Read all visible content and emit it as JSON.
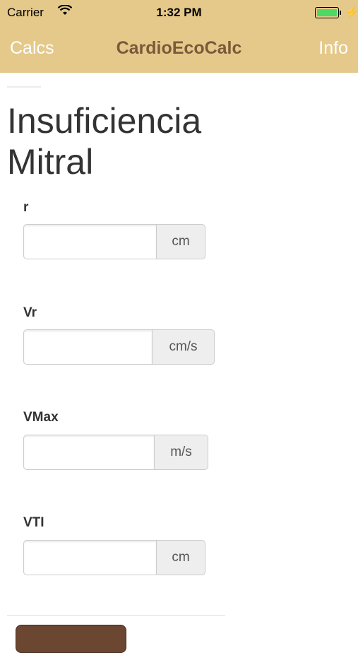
{
  "status_bar": {
    "carrier": "Carrier",
    "time": "1:32 PM",
    "wifi_icon": "wifi-icon",
    "battery_icon": "battery-icon",
    "charging_icon": "charging-bolt-icon",
    "battery_level": 1.0,
    "battery_color": "#4cd964"
  },
  "nav": {
    "left_label": "Calcs",
    "title": "CardioEcoCalc",
    "right_label": "Info",
    "background_color": "#e5c98a",
    "title_color": "#7a5a3a"
  },
  "page": {
    "title": "Insuficiencia Mitral"
  },
  "fields": [
    {
      "label": "r",
      "unit": "cm",
      "value": "",
      "placeholder": ""
    },
    {
      "label": "Vr",
      "unit": "cm/s",
      "value": "",
      "placeholder": ""
    },
    {
      "label": "VMax",
      "unit": "m/s",
      "value": "",
      "placeholder": ""
    },
    {
      "label": "VTI",
      "unit": "cm",
      "value": "",
      "placeholder": ""
    }
  ],
  "button_color": "#6b4630"
}
